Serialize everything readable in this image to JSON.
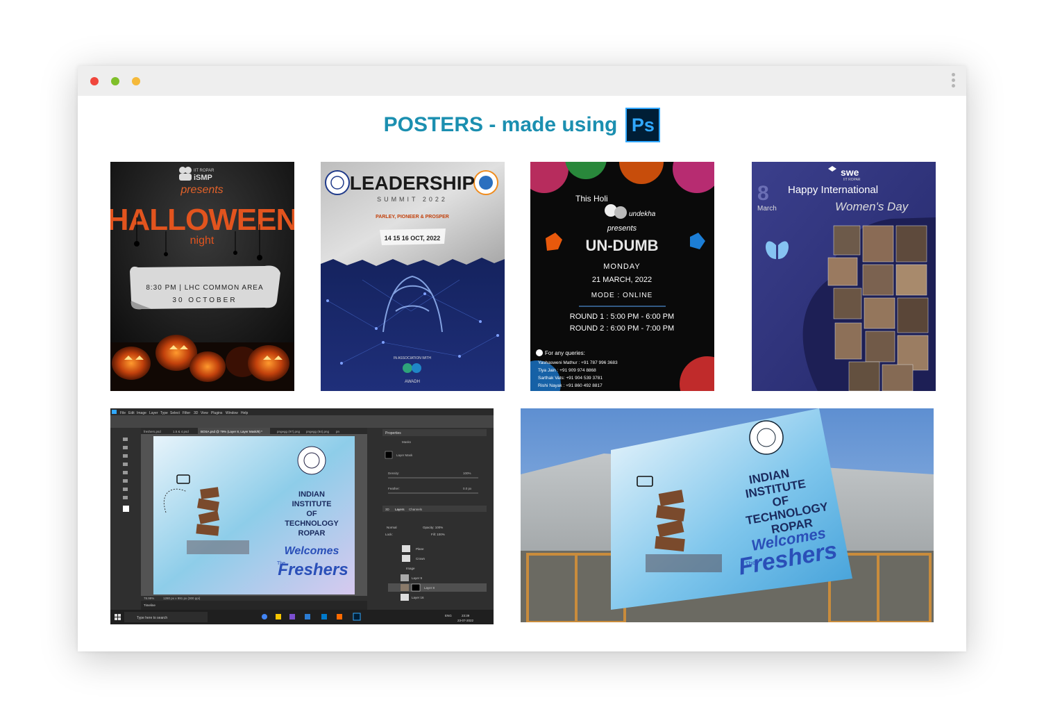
{
  "heading": {
    "text": "POSTERS - made using",
    "ps_logo": "Ps"
  },
  "colors": {
    "heading": "#1b8fb0",
    "close": "#f0463c",
    "minimize": "#7fbf2a",
    "maximize": "#f5b93a"
  },
  "window": {
    "controls": [
      "close-dot",
      "minimize-dot",
      "maximize-dot"
    ],
    "menu_icon": "kebab-icon"
  },
  "posters": {
    "halloween": {
      "org": "IIT ROPAR",
      "org_short": "iSMP",
      "presents": "presents",
      "title": "HALLOWEEN",
      "subtitle": "night",
      "time_venue": "8:30 PM | LHC COMMON AREA",
      "date": "30 OCTOBER"
    },
    "leadership": {
      "title": "LEADERSHIP",
      "subtitle": "SUMMIT 2022",
      "tagline": "PARLEY, PIONEER & PROSPER",
      "dates": "14 15 16 OCT, 2022",
      "association": "IN ASSOCIATION WITH",
      "partner": "AWADH"
    },
    "holi": {
      "intro": "This Holi",
      "club": "undekha",
      "presents": "presents",
      "title": "UN-DUMB",
      "day": "MONDAY",
      "date": "21 MARCH, 2022",
      "mode": "MODE : ONLINE",
      "round1": "ROUND 1 : 5:00 PM - 6:00 PM",
      "round2": "ROUND 2 : 6:00 PM - 7:00 PM",
      "queries": "For any queries:",
      "contact1": "Yashasweni Mathur : +91 787 996 3683",
      "contact2": "Tiya Jain : +91 909 974 8868",
      "contact3": "Sarthak Vats: +91 904 539 3781",
      "contact4": "Rishi Nayak : +91 860 492 8817"
    },
    "womens_day": {
      "org": "swe",
      "org_sub": "IIT ROPAR",
      "date_num": "8",
      "month": "March",
      "line1": "Happy International",
      "line2": "Women's Day"
    },
    "photoshop": {
      "menu": [
        "File",
        "Edit",
        "Image",
        "Layer",
        "Type",
        "Select",
        "Filter",
        "3D",
        "View",
        "Plugins",
        "Window",
        "Help"
      ],
      "tabs": [
        "freshers.psd",
        "1.5 & 4.psd",
        "BOSA.psd @ 79% (Layer 8, Layer Mask/8) *",
        "pngegg (97).png",
        "pngegg (84).png",
        "pn"
      ],
      "zoom": "78.99%",
      "doc_size": "1280 px x 991 px (300 ppi)",
      "timeline": "Timeline",
      "properties": "Properties",
      "masks": "Masks",
      "layer_mask": "Layer Mask",
      "density": "Density:",
      "density_val": "100%",
      "feather": "Feather:",
      "feather_val": "0.0 px",
      "panel_tabs": [
        "3D",
        "Layers",
        "Channels"
      ],
      "blend": "Normal",
      "opacity": "Opacity: 100%",
      "lock": "Lock:",
      "fill": "Fill: 100%",
      "layers": [
        "Plane",
        "Crown",
        "Image",
        "Layer 9",
        "Layer 8",
        "Layer 16"
      ],
      "canvas_lines": [
        "INDIAN",
        "INSTITUTE",
        "OF",
        "TECHNOLOGY",
        "ROPAR"
      ],
      "welcomes": "Welcomes",
      "the": "The",
      "freshers": "Freshers",
      "search": "Type here to search",
      "time": "23:39",
      "date": "23-07-2022",
      "lang": "ENG"
    },
    "banner": {
      "lines": [
        "INDIAN",
        "INSTITUTE",
        "OF",
        "TECHNOLOGY",
        "ROPAR"
      ],
      "welcomes": "Welcomes",
      "the": "The",
      "freshers": "Freshers"
    }
  }
}
